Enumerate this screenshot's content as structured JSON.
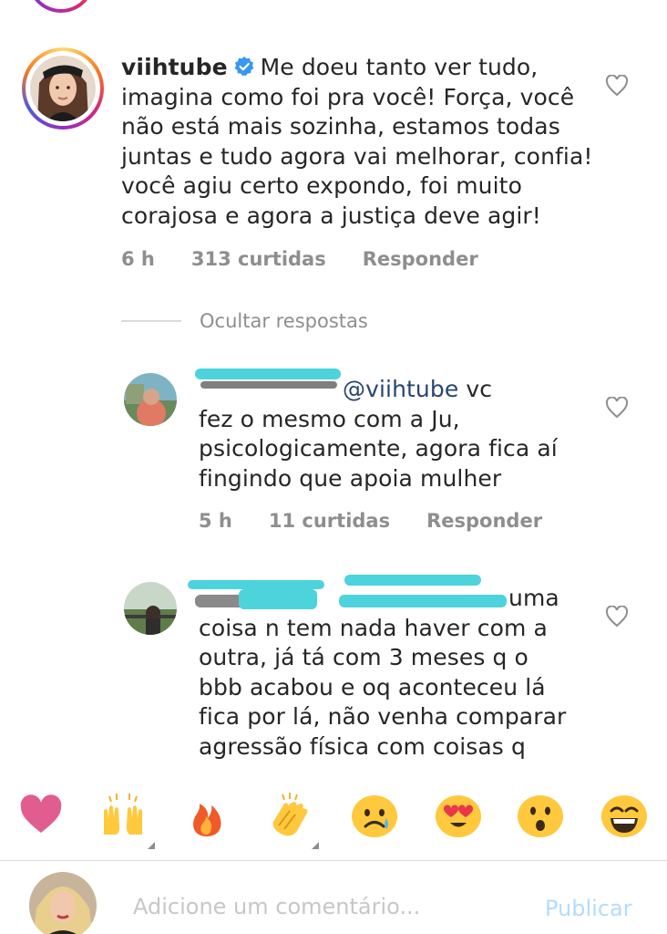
{
  "comments": {
    "main": {
      "username": "viihtube",
      "text_lines": [
        "Me doeu tanto ver tudo,",
        "imagina como foi pra você! Força, você",
        "não está mais sozinha, estamos todas",
        "juntas e tudo agora vai melhorar, confia!",
        "você agiu certo expondo, foi muito",
        "corajosa e agora a justiça deve agir!"
      ],
      "time": "6 h",
      "likes": "313 curtidas",
      "reply": "Responder"
    },
    "hide_replies": "Ocultar respostas",
    "reply1": {
      "mention": "@viihtube",
      "text_first": "vc",
      "text_lines": [
        "fez o mesmo com a Ju,",
        "psicologicamente,  agora fica aí",
        "fingindo que apoia mulher"
      ],
      "time": "5 h",
      "likes": "11 curtidas",
      "reply": "Responder"
    },
    "reply2": {
      "text_first": "uma",
      "text_lines": [
        "coisa n tem nada haver com a",
        "outra, já tá com 3 meses q o",
        "bbb acabou e oq aconteceu lá",
        "fica por lá, não venha comparar",
        "agressão física com coisas q"
      ]
    }
  },
  "emoji_bar": {
    "items": [
      "heart",
      "raised-hands",
      "fire",
      "clapping-hands",
      "sad-face",
      "heart-eyes-face",
      "surprised-face",
      "laughing-face"
    ]
  },
  "composer": {
    "placeholder": "Adicione um comentário...",
    "post_label": "Publicar"
  },
  "colors": {
    "text": "#262626",
    "muted": "#8e8e8e",
    "mention": "#27466d",
    "verified": "#3897f0",
    "scribble": "#4dd3dc",
    "post_disabled": "#b3dbff"
  }
}
